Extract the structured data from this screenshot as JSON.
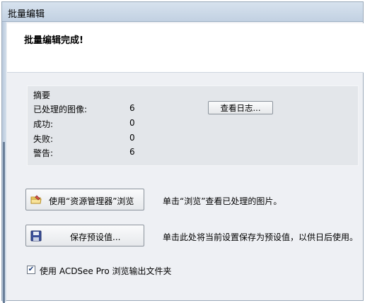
{
  "window": {
    "title": "批量编辑"
  },
  "header": {
    "message": "批量编辑完成!"
  },
  "summary": {
    "title": "摘要",
    "rows": [
      {
        "label": "已处理的图像:",
        "value": "6"
      },
      {
        "label": "成功:",
        "value": "0"
      },
      {
        "label": "失败:",
        "value": "0"
      },
      {
        "label": "警告:",
        "value": "6"
      }
    ],
    "view_log_button": "查看日志..."
  },
  "actions": {
    "explorer_button": "使用“资源管理器”浏览",
    "explorer_desc": "单击“浏览”查看已处理的图片。",
    "save_button": "保存预设值...",
    "save_desc": "单击此处将当前设置保存为预设值，以供日后使用。"
  },
  "option": {
    "checked": true,
    "label": "使用 ACDSee Pro 浏览输出文件夹"
  },
  "icons": {
    "explorer": "folder-pen-icon",
    "save": "floppy-disk-icon",
    "check": "checkmark-icon"
  }
}
